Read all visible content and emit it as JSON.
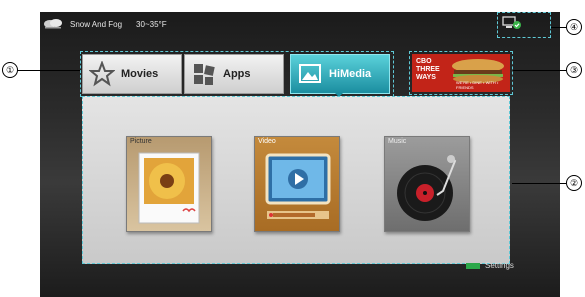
{
  "status_bar": {
    "weather_icon": "cloud-fog-icon",
    "weather": "Snow And Fog",
    "temperature": "30~35°F",
    "device_icon": "network-device-icon"
  },
  "tabs": [
    {
      "label": "Movies",
      "icon": "star-icon",
      "active": false
    },
    {
      "label": "Apps",
      "icon": "apps-grid-icon",
      "active": false
    },
    {
      "label": "HiMedia",
      "icon": "image-icon",
      "active": true
    }
  ],
  "ad": {
    "headline": [
      "CBO",
      "THREE",
      "WAYS"
    ],
    "subline": "WE'RE • DINE • WITH • FRIENDS"
  },
  "media": [
    {
      "label": "Picture",
      "icon": "picture-icon"
    },
    {
      "label": "Video",
      "icon": "video-icon"
    },
    {
      "label": "Music",
      "icon": "music-icon"
    }
  ],
  "footer": {
    "settings_label": "Settings",
    "settings_color": "#2ca84a"
  },
  "callouts": [
    "①",
    "②",
    "③",
    "④"
  ],
  "colors": {
    "accent": "#2aa8b8",
    "highlight_border": "#5fc9d6",
    "ad_red": "#c22418"
  }
}
